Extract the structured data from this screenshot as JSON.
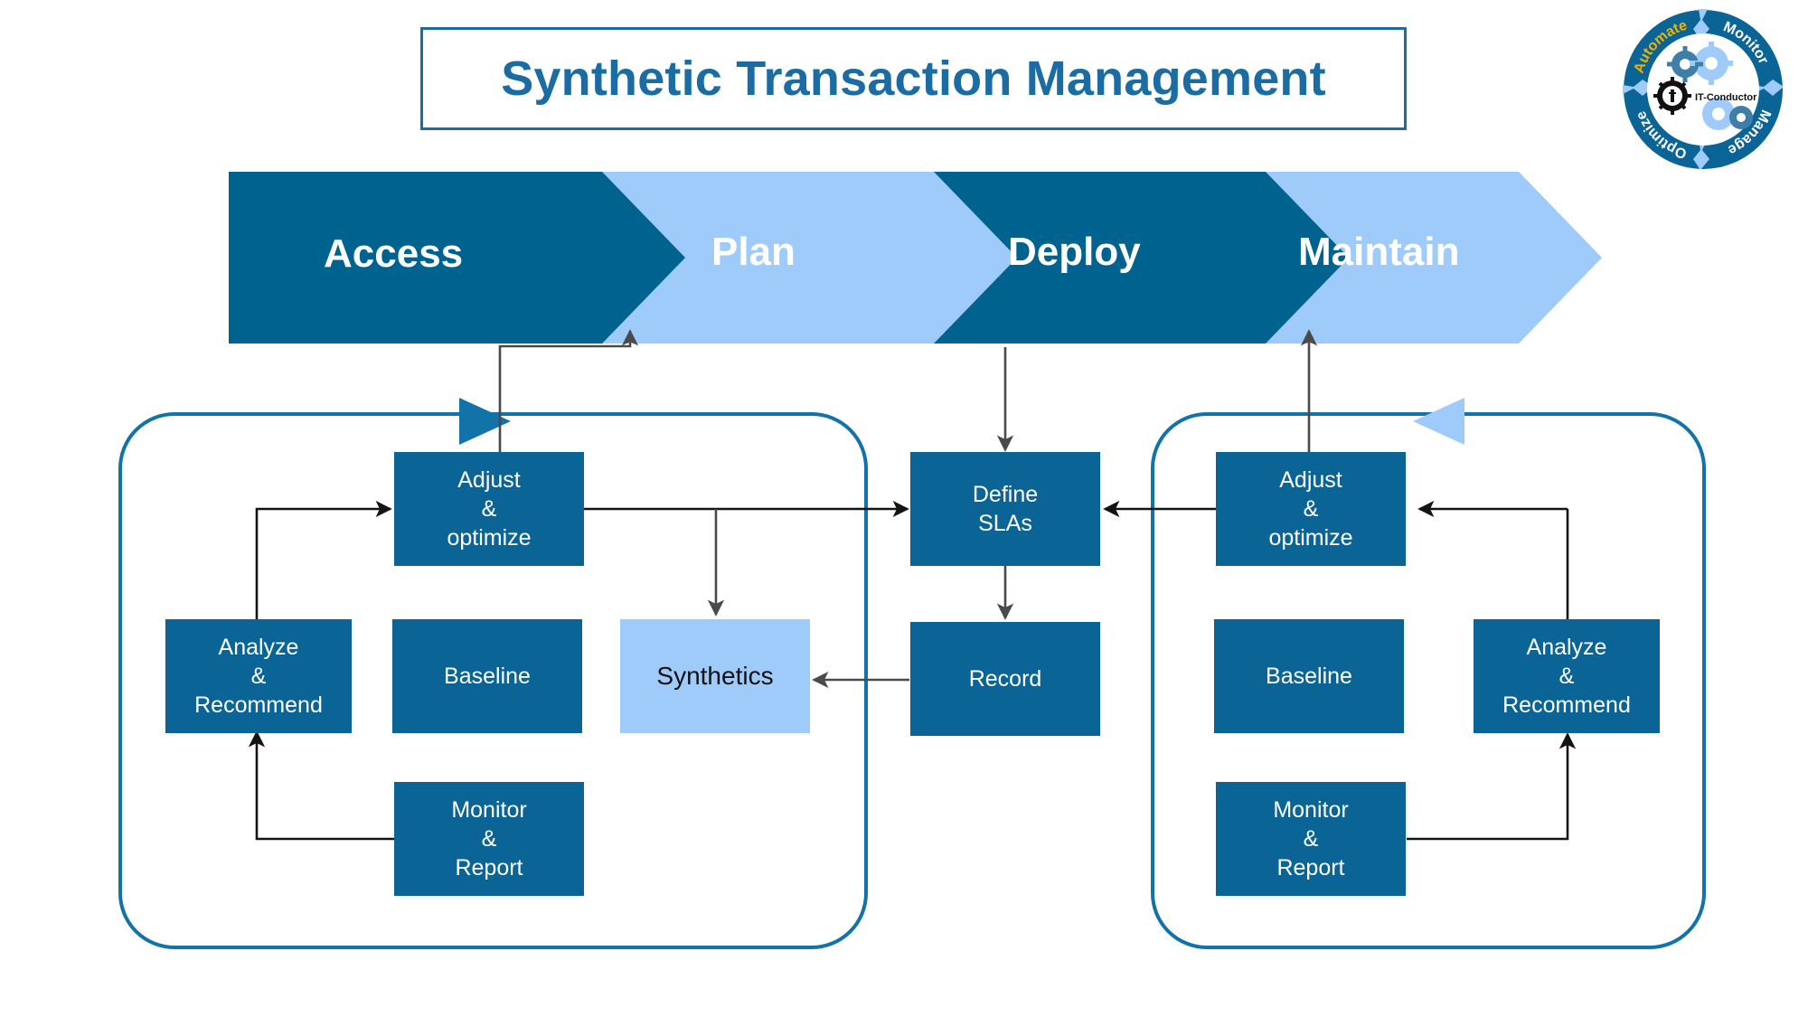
{
  "page": {
    "title": "Synthetic Transaction Management",
    "background": "#ffffff"
  },
  "colors": {
    "dark_blue": "#0a6496",
    "light_blue": "#9ecbfa",
    "title_blue": "#1b6ca3",
    "container_stroke": "#1273a8",
    "connector": "#3f3f3f",
    "white": "#ffffff"
  },
  "logo": {
    "brand": "IT-Conductor",
    "ring_labels": [
      "Automate",
      "Monitor",
      "Manage",
      "Optimize"
    ],
    "highlight_label": "Automate",
    "highlight_color": "#f0b400",
    "ring_color": "#0a6496",
    "gear_color": "#9ecbfa"
  },
  "process_banner": {
    "stages": [
      {
        "label": "Access",
        "fill": "dark"
      },
      {
        "label": "Plan",
        "fill": "light"
      },
      {
        "label": "Deploy",
        "fill": "dark"
      },
      {
        "label": "Maintain",
        "fill": "light"
      }
    ]
  },
  "left_group": {
    "name": "access-cycle",
    "nodes": [
      {
        "id": "adjust",
        "label": "Adjust\n&\noptimize",
        "fill": "dark"
      },
      {
        "id": "analyze",
        "label": "Analyze\n&\nRecommend",
        "fill": "dark"
      },
      {
        "id": "baseline",
        "label": "Baseline",
        "fill": "dark"
      },
      {
        "id": "monitor",
        "label": "Monitor\n&\nReport",
        "fill": "dark"
      },
      {
        "id": "synthetics",
        "label": "Synthetics",
        "fill": "light"
      }
    ]
  },
  "center_group": {
    "name": "deploy-column",
    "nodes": [
      {
        "id": "define-slas",
        "label": "Define\nSLAs",
        "fill": "dark"
      },
      {
        "id": "record",
        "label": "Record",
        "fill": "dark"
      }
    ]
  },
  "right_group": {
    "name": "maintain-cycle",
    "nodes": [
      {
        "id": "adjust-r",
        "label": "Adjust\n&\noptimize",
        "fill": "dark"
      },
      {
        "id": "baseline-r",
        "label": "Baseline",
        "fill": "dark"
      },
      {
        "id": "analyze-r",
        "label": "Analyze\n&\nRecommend",
        "fill": "dark"
      },
      {
        "id": "monitor-r",
        "label": "Monitor\n&\nReport",
        "fill": "dark"
      }
    ]
  },
  "labels": {
    "adjust_l1": "Adjust",
    "adjust_l2": "&",
    "adjust_l3": "optimize",
    "analyze_l1": "Analyze",
    "analyze_l2": "&",
    "analyze_l3": "Recommend",
    "monitor_l1": "Monitor",
    "monitor_l2": "&",
    "monitor_l3": "Report",
    "baseline": "Baseline",
    "synthetics": "Synthetics",
    "define_l1": "Define",
    "define_l2": "SLAs",
    "record": "Record",
    "stage_access": "Access",
    "stage_plan": "Plan",
    "stage_deploy": "Deploy",
    "stage_maintain": "Maintain",
    "logo_brand": "IT-Conductor",
    "ring_automate": "Automate",
    "ring_monitor": "Monitor",
    "ring_manage": "Manage",
    "ring_optimize": "Optimize"
  }
}
